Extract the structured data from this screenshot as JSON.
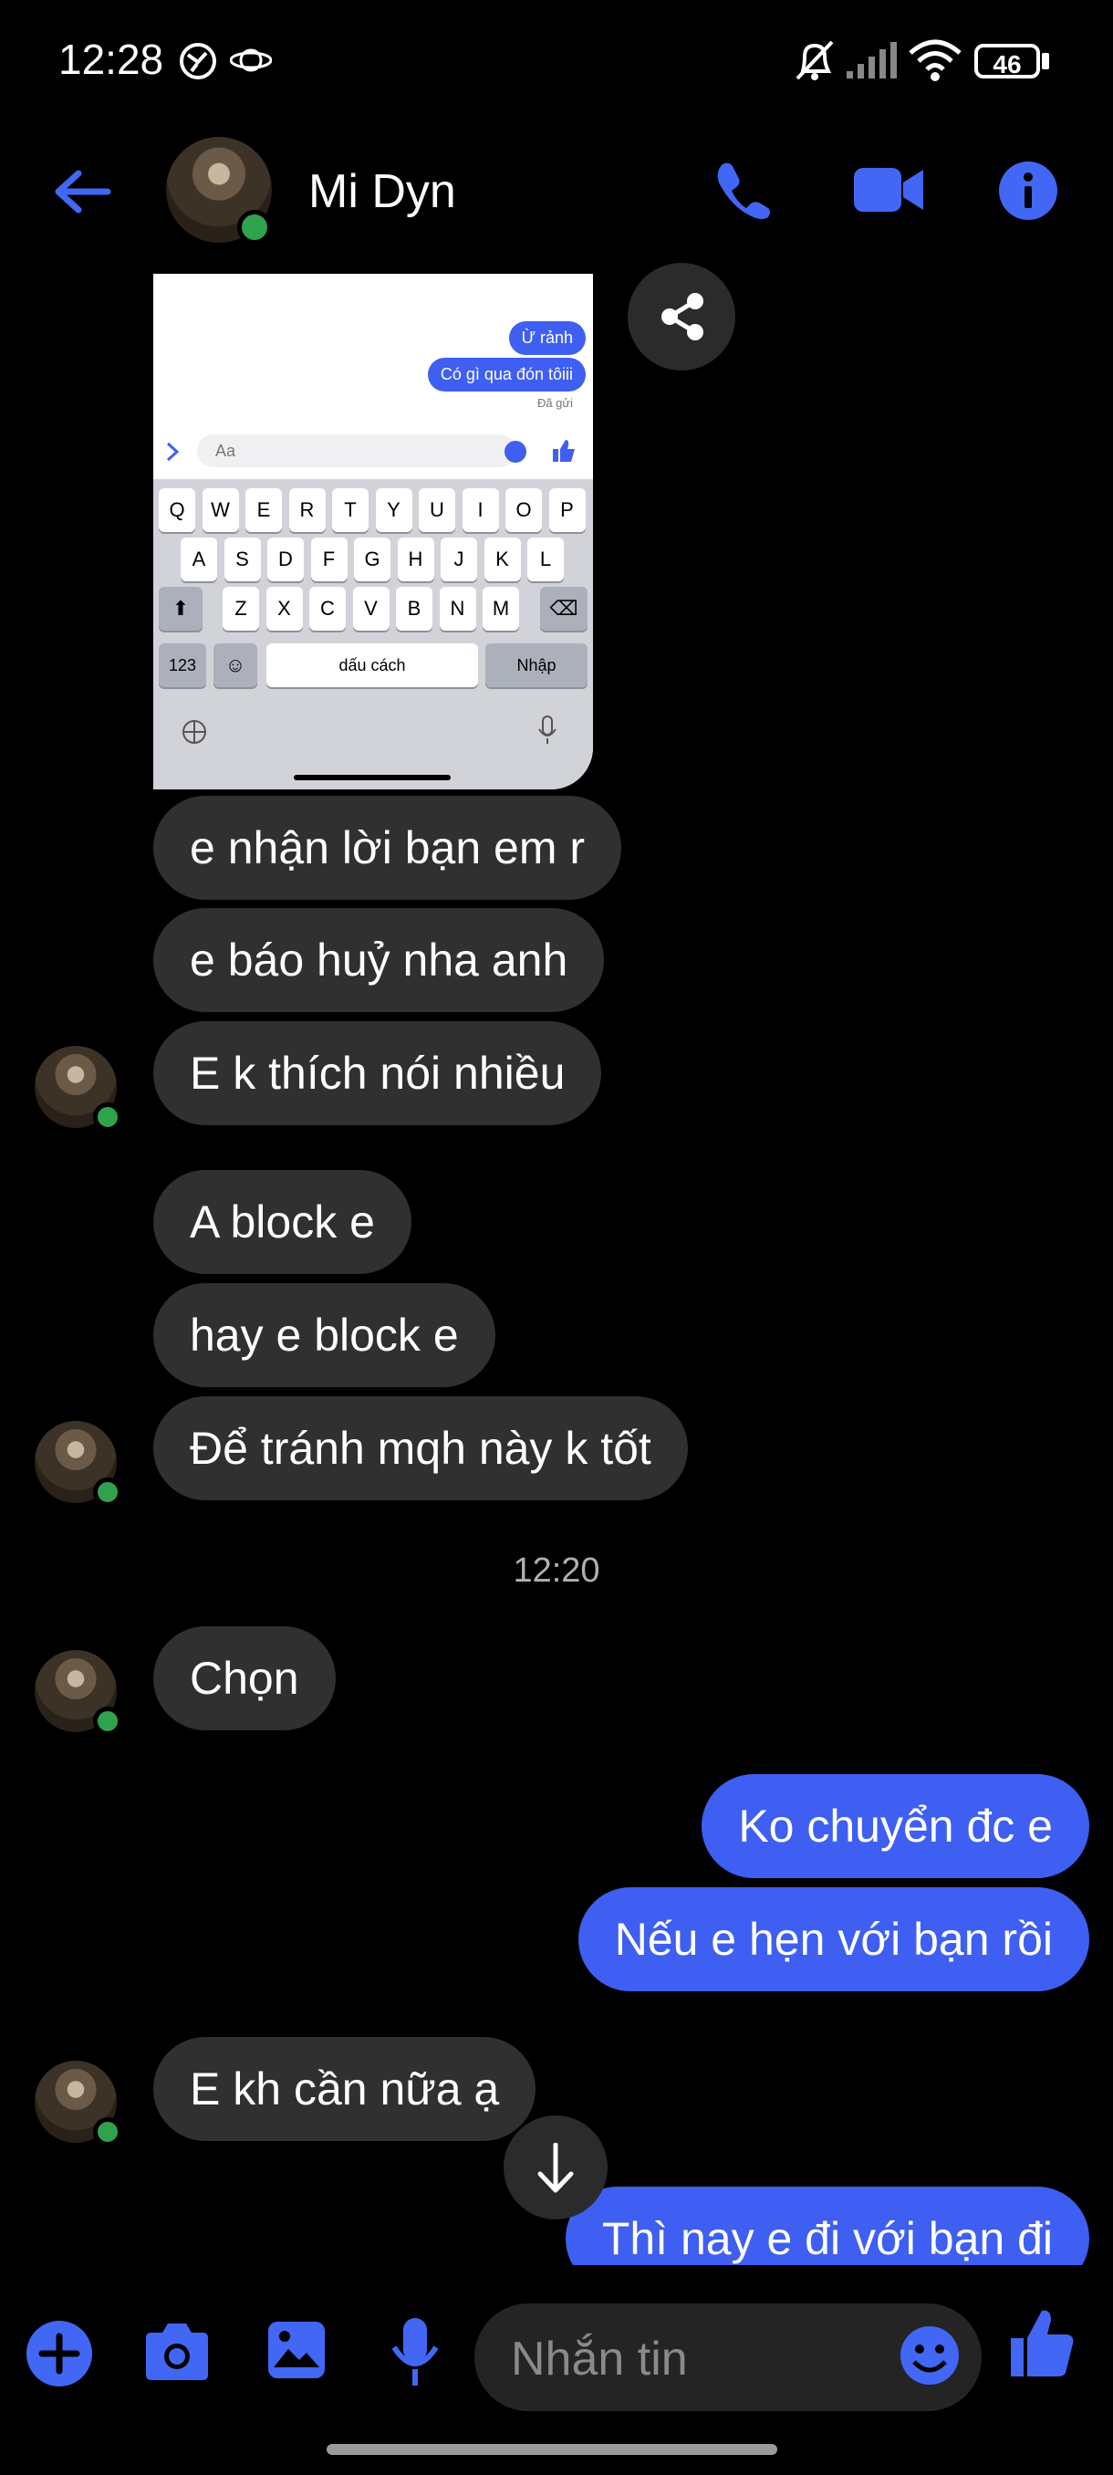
{
  "status_bar": {
    "time": "12:28",
    "battery": "46"
  },
  "header": {
    "contact_name": "Mi Dyn"
  },
  "shared_image": {
    "msg1": "Ừ rảnh",
    "msg2": "Có gì qua đón tôiii",
    "sent_label": "Đã gửi",
    "input_placeholder": "Aa",
    "row1": [
      "Q",
      "W",
      "E",
      "R",
      "T",
      "Y",
      "U",
      "I",
      "O",
      "P"
    ],
    "row2": [
      "A",
      "S",
      "D",
      "F",
      "G",
      "H",
      "J",
      "K",
      "L"
    ],
    "row3": [
      "Z",
      "X",
      "C",
      "V",
      "B",
      "N",
      "M"
    ],
    "key_123": "123",
    "space_label": "dấu cách",
    "enter_label": "Nhập"
  },
  "messages": [
    {
      "side": "in",
      "text": "e nhận lời bạn em r"
    },
    {
      "side": "in",
      "text": "e báo huỷ nha anh"
    },
    {
      "side": "in",
      "text": "E k thích nói nhiều"
    },
    {
      "side": "in",
      "text": "A block e"
    },
    {
      "side": "in",
      "text": "hay e block e"
    },
    {
      "side": "in",
      "text": "Để tránh mqh này k tốt"
    },
    {
      "side": "in",
      "text": "Chọn"
    },
    {
      "side": "out",
      "text": "Ko chuyển đc e"
    },
    {
      "side": "out",
      "text": "Nếu e hẹn với bạn rồi"
    },
    {
      "side": "in",
      "text": "E kh cần nữa ạ"
    },
    {
      "side": "out",
      "text": "Thì nay e đi với bạn đi"
    }
  ],
  "timestamp": "12:20",
  "composer": {
    "placeholder": "Nhắn tin"
  },
  "colors": {
    "accent": "#3e5ff1",
    "incoming_bubble": "#303030",
    "online": "#31a24c"
  },
  "icons": [
    "back-arrow-icon",
    "phone-icon",
    "video-camera-icon",
    "info-icon",
    "share-icon",
    "scroll-down-arrow-icon",
    "plus-icon",
    "camera-icon",
    "gallery-icon",
    "microphone-icon",
    "emoji-icon",
    "thumbs-up-icon"
  ]
}
